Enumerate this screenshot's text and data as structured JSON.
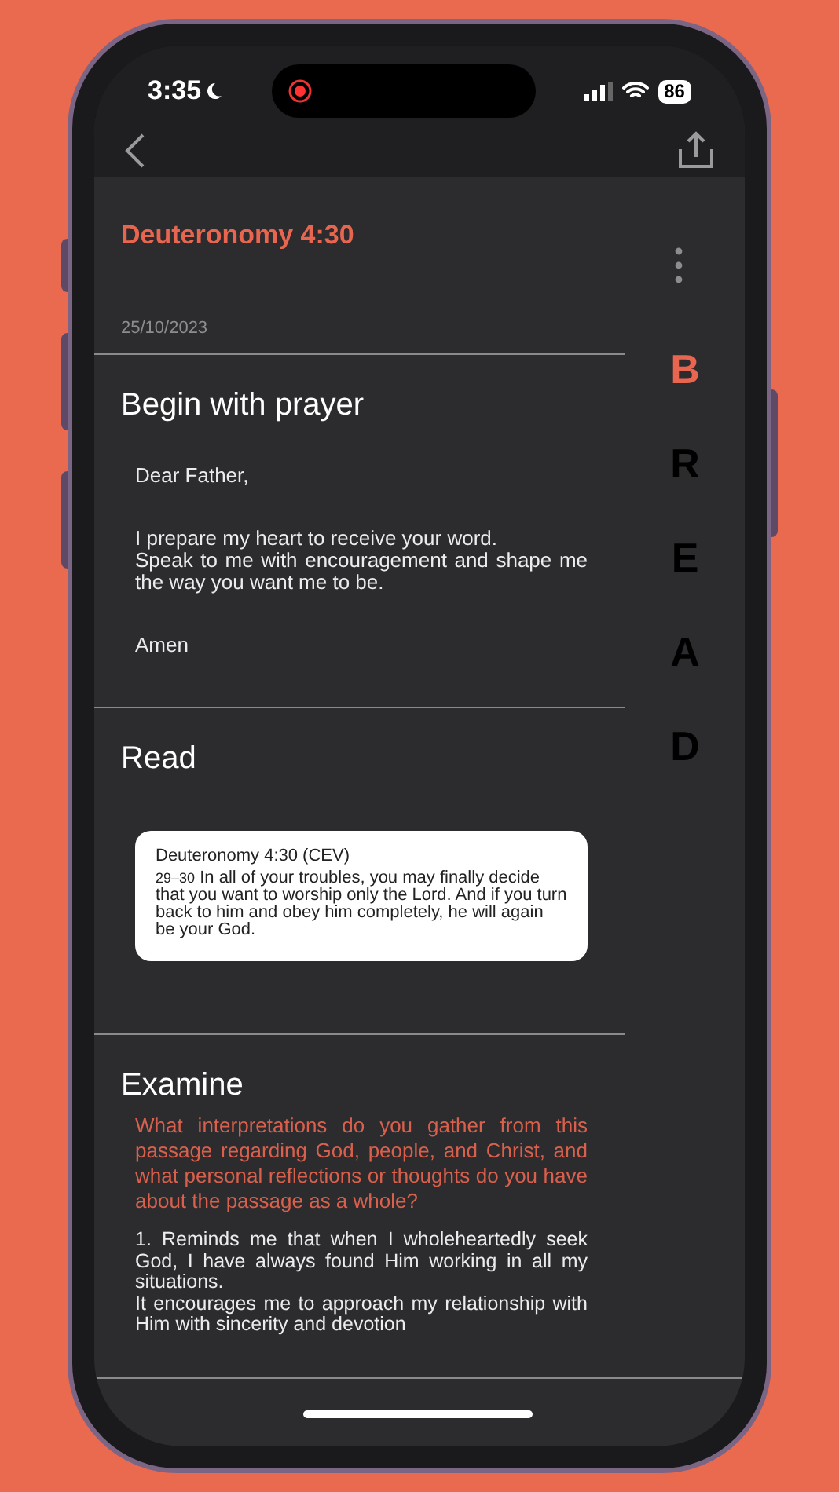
{
  "status_bar": {
    "time": "3:35",
    "battery": "86"
  },
  "entry": {
    "title": "Deuteronomy 4:30",
    "date": "25/10/2023"
  },
  "bread_index": [
    {
      "letter": "B",
      "selected": true
    },
    {
      "letter": "R",
      "selected": false
    },
    {
      "letter": "E",
      "selected": false
    },
    {
      "letter": "A",
      "selected": false
    },
    {
      "letter": "D",
      "selected": false
    }
  ],
  "sections": [
    {
      "kind": "prayer",
      "heading": "Begin with prayer",
      "paragraphs": [
        "Dear Father,",
        "I prepare my heart to receive your word.\nSpeak to me with encouragement and shape me the way you want me to be.",
        "Amen"
      ]
    },
    {
      "kind": "passage",
      "heading": "Read",
      "card": {
        "reference": "Deuteronomy 4:30 (CEV)",
        "verse_number": "29–30",
        "text": "In all of your troubles, you may finally decide that you want to worship only the Lord. And if you turn back to him and obey him completely, he will again be your God."
      }
    },
    {
      "kind": "question",
      "heading": "Examine",
      "question": "What interpretations do you gather from this passage regarding God, people, and Christ, and what personal reflections or thoughts do you have about the passage as a whole?",
      "answer": "1. Reminds me that when I wholeheartedly seek God, I have always found Him working in all my situations.\nIt encourages me to approach my relationship with Him with sincerity and devotion"
    }
  ]
}
